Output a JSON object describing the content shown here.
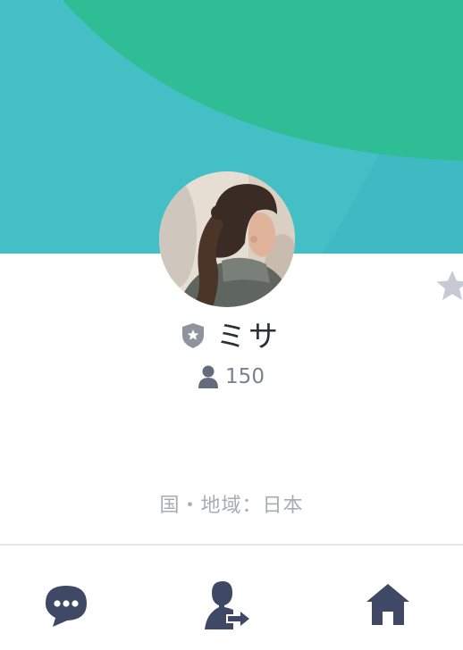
{
  "profile": {
    "name": "ミサ",
    "friend_count": "150",
    "region": "国・地域：日本"
  },
  "icons": {
    "favorite": "star-icon",
    "official_badge": "shield-star-icon",
    "friends": "person-icon",
    "chat": "chat-bubble-icon",
    "share": "person-share-icon",
    "home": "home-icon"
  },
  "colors": {
    "cover_teal": "#45bfc6",
    "cover_green": "#2ebd94",
    "icon_navy": "#3f4965",
    "star_gray": "#c5cad4",
    "text_dark": "#2b2f3a",
    "text_gray": "#7c818d",
    "text_light": "#a8abb3"
  }
}
